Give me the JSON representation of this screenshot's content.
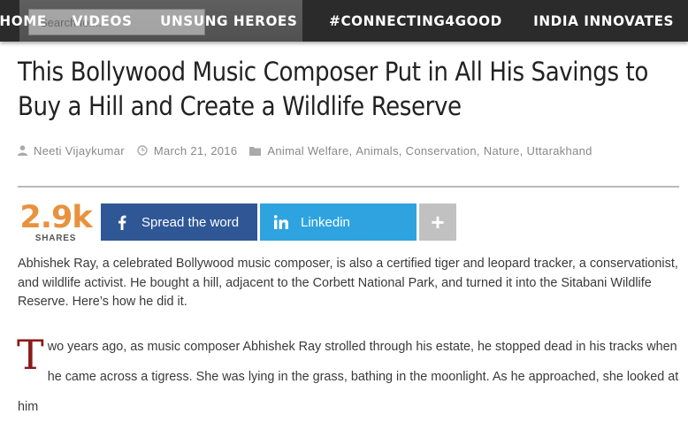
{
  "nav": {
    "search_placeholder": "Search for...",
    "items": [
      "HOME",
      "VIDEOS",
      "UNSUNG HEROES",
      "#CONNECTING4GOOD",
      "INDIA INNOVATES"
    ]
  },
  "article": {
    "title": "This Bollywood Music Composer Put in All His Savings to Buy a Hill and Create a Wildlife Reserve",
    "author": "Neeti Vijaykumar",
    "date": "March 21, 2016",
    "categories": [
      "Animal Welfare",
      "Animals",
      "Conservation",
      "Nature",
      "Uttarakhand"
    ],
    "intro": "Abhishek Ray, a celebrated Bollywood music composer, is also a certified tiger and leopard tracker, a conservationist, and wildlife activist. He bought a hill, adjacent to the Corbett National Park, and turned it into the Sitabani Wildlife Reserve. Here’s how he did it.",
    "dropcap": "T",
    "body": "wo years ago, as music composer Abhishek Ray strolled through his estate, he stopped dead in his tracks when he came across a tigress. She was lying in the grass, bathing in the moonlight. As he approached, she looked at him"
  },
  "share": {
    "count": "2.9k",
    "count_label": "SHARES",
    "facebook_label": "Spread the word",
    "linkedin_label": "Linkedin",
    "more_label": "+"
  },
  "colors": {
    "nav_bg": "#2b2b2b",
    "share_count": "#e8923f",
    "facebook": "#2f5796",
    "linkedin": "#2ea3e0",
    "more": "#c1c1c1",
    "dropcap": "#8b1a1a"
  },
  "icons": {
    "author": "user-icon",
    "date": "clock-icon",
    "category": "folder-icon",
    "facebook": "facebook-icon",
    "linkedin": "linkedin-icon",
    "more": "plus-icon"
  }
}
